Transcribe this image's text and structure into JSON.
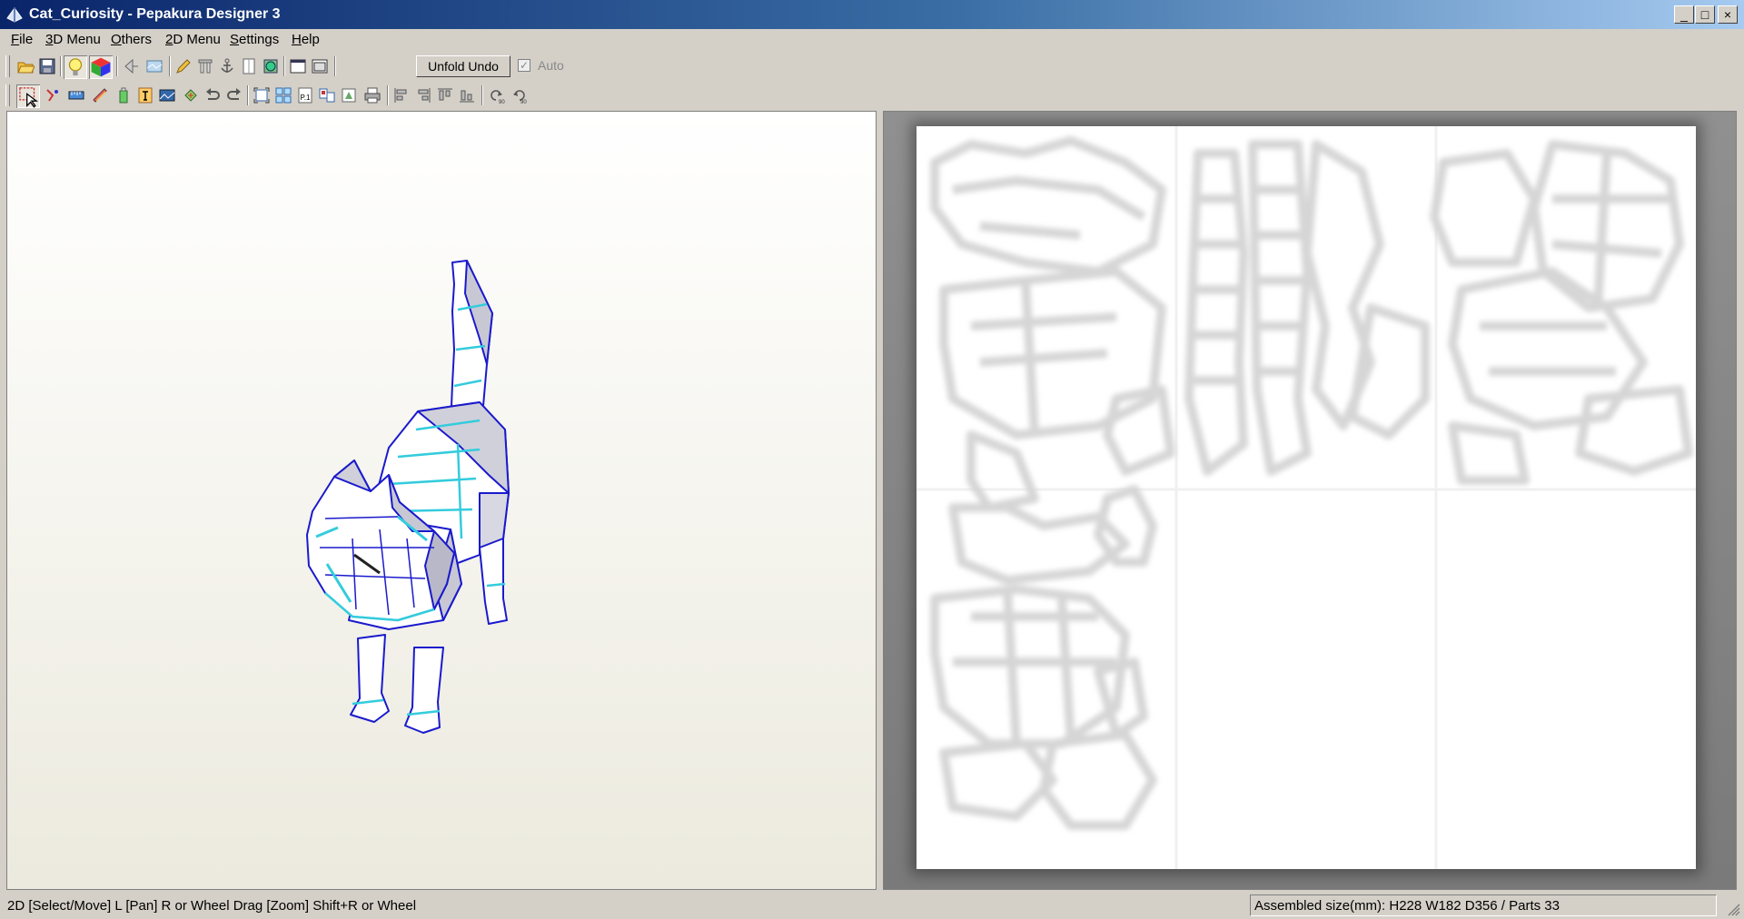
{
  "window": {
    "title": "Cat_Curiosity - Pepakura Designer 3",
    "minimize": "_",
    "maximize": "□",
    "close": "×"
  },
  "menu": {
    "file": {
      "accel": "F",
      "rest": "ile"
    },
    "menu3d": {
      "accel": "3",
      "rest": "D Menu"
    },
    "others": {
      "accel": "O",
      "rest": "thers"
    },
    "menu2d": {
      "accel": "2",
      "rest": "D Menu"
    },
    "settings": {
      "accel": "S",
      "rest": "ettings"
    },
    "help": {
      "accel": "H",
      "rest": "elp"
    }
  },
  "toolbar1": {
    "unfold_undo": "Unfold Undo",
    "auto_label": "Auto",
    "auto_checked": "✓",
    "icons": [
      "open-icon",
      "save-icon",
      "lightbulb-icon",
      "color-cube-icon",
      "flip-icon",
      "texture-icon",
      "pencil-icon",
      "column-icon",
      "anchor-icon",
      "page-icon",
      "globe-icon",
      "window-single-icon",
      "window-dual-icon"
    ]
  },
  "toolbar2": {
    "page_label": "P.1",
    "rotate_left_label": "90",
    "rotate_right_label": "90",
    "icons": [
      "select-icon",
      "join-edge-icon",
      "ruler-icon",
      "edit-icon",
      "glue-icon",
      "text-icon",
      "image-icon",
      "move-parts-icon",
      "undo-icon",
      "redo-icon",
      "fit-icon",
      "arrange-icon",
      "page-number-icon",
      "print-preview-icon",
      "export-icon",
      "print-icon",
      "align-left-icon",
      "align-right-icon",
      "align-top-icon",
      "align-bottom-icon",
      "rotate-left-icon",
      "rotate-right-icon"
    ]
  },
  "status": {
    "left": "2D [Select/Move] L [Pan] R or Wheel Drag [Zoom] Shift+R or Wheel",
    "right": "Assembled size(mm): H228 W182 D356 / Parts 33"
  },
  "colors": {
    "model_edge": "#1a1acc",
    "model_fold": "#33ccdd",
    "model_face": "#ffffff",
    "titlebar_start": "#0a246a",
    "titlebar_end": "#a6caf0"
  }
}
